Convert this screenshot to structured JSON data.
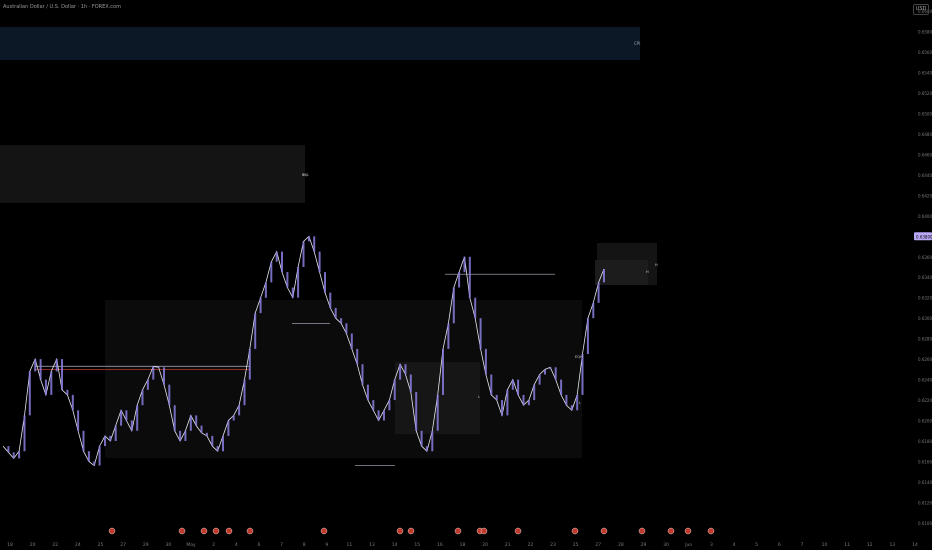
{
  "header": {
    "symbol_title": "Australian Dollar / U.S. Dollar · 1h · FOREX.com",
    "currency": "USD"
  },
  "colors": {
    "background": "#000000",
    "wick": "#e6e6f0",
    "body": "#8a7fe0",
    "level_line": "#b7b7c7",
    "red_line": "#c0392b",
    "current_price_badge": "#b9a8f5",
    "zone_blue": "#0d1826",
    "zone_grey": "#141414"
  },
  "chart_data": {
    "type": "line",
    "y_axis": {
      "ticks": [
        "0.66000",
        "0.65800",
        "0.65600",
        "0.65400",
        "0.65200",
        "0.65000",
        "0.64800",
        "0.64600",
        "0.64400",
        "0.64200",
        "0.64000",
        "0.63800",
        "0.63600",
        "0.63400",
        "0.63200",
        "0.63000",
        "0.62800",
        "0.62600",
        "0.62400",
        "0.62200",
        "0.62000",
        "0.61800",
        "0.61600",
        "0.61400",
        "0.61200",
        "0.61000"
      ],
      "range": [
        0.6095,
        0.6605
      ]
    },
    "current_price": "0.63800",
    "x_axis": {
      "ticks": [
        "18",
        "20",
        "22",
        "24",
        "25",
        "27",
        "29",
        "30",
        "May",
        "2",
        "4",
        "6",
        "7",
        "8",
        "9",
        "11",
        "13",
        "14",
        "15",
        "16",
        "18",
        "20",
        "21",
        "22",
        "23",
        "25",
        "27",
        "28",
        "29",
        "30",
        "Jun",
        "3",
        "4",
        "5",
        "6",
        "7",
        "10",
        "11",
        "12",
        "13",
        "14"
      ]
    },
    "price_series": {
      "name": "",
      "values": [
        0.6175,
        0.6169,
        0.6163,
        0.617,
        0.6205,
        0.6248,
        0.626,
        0.624,
        0.6225,
        0.6248,
        0.626,
        0.623,
        0.6225,
        0.621,
        0.619,
        0.617,
        0.616,
        0.6156,
        0.6175,
        0.6185,
        0.618,
        0.6195,
        0.621,
        0.62,
        0.619,
        0.6215,
        0.623,
        0.624,
        0.6253,
        0.6252,
        0.6235,
        0.6215,
        0.619,
        0.618,
        0.619,
        0.6205,
        0.6195,
        0.6188,
        0.6185,
        0.6175,
        0.617,
        0.6185,
        0.62,
        0.6205,
        0.6215,
        0.624,
        0.627,
        0.6305,
        0.632,
        0.6335,
        0.6355,
        0.6365,
        0.6345,
        0.633,
        0.632,
        0.635,
        0.6375,
        0.638,
        0.6365,
        0.6345,
        0.6325,
        0.631,
        0.63,
        0.6295,
        0.6285,
        0.627,
        0.6255,
        0.6235,
        0.622,
        0.621,
        0.62,
        0.621,
        0.622,
        0.624,
        0.6255,
        0.6245,
        0.6228,
        0.619,
        0.6175,
        0.617,
        0.619,
        0.6225,
        0.627,
        0.6295,
        0.633,
        0.6345,
        0.636,
        0.632,
        0.63,
        0.627,
        0.6245,
        0.6225,
        0.622,
        0.6205,
        0.623,
        0.624,
        0.6225,
        0.6215,
        0.622,
        0.6235,
        0.6245,
        0.625,
        0.6252,
        0.624,
        0.6225,
        0.6215,
        0.621,
        0.6225,
        0.6265,
        0.63,
        0.6315,
        0.6335,
        0.6348
      ]
    },
    "levels": [
      {
        "name": "red-level",
        "value": 0.625
      },
      {
        "name": "grey-level-1",
        "value": 0.6253
      },
      {
        "name": "high-level",
        "value": 0.6343
      },
      {
        "name": "mid-level",
        "value": 0.6295
      },
      {
        "name": "low-level",
        "value": 0.6156
      }
    ],
    "markers": {
      "event_label": "CPI",
      "small_labels": [
        "H",
        "EQL",
        "L",
        "EQH",
        "L",
        "H",
        "H"
      ]
    }
  }
}
